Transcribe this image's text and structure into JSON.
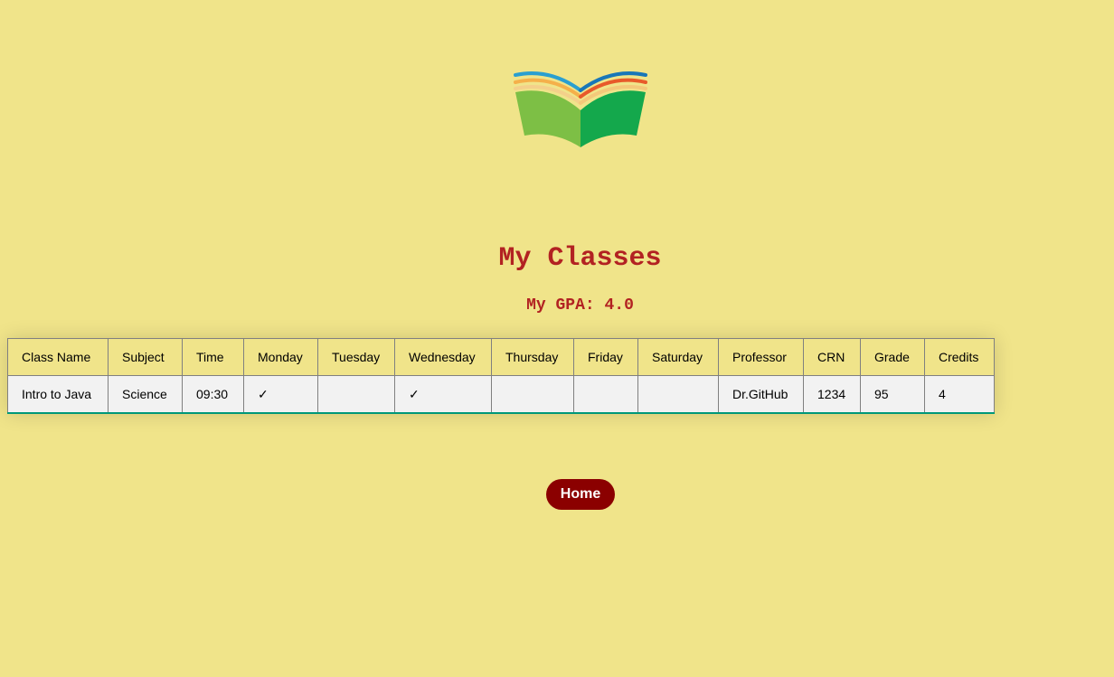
{
  "title": "My Classes",
  "gpa": "My GPA: 4.0",
  "logo_icon": "open-book-icon",
  "table": {
    "headers": [
      "Class Name",
      "Subject",
      "Time",
      "Monday",
      "Tuesday",
      "Wednesday",
      "Thursday",
      "Friday",
      "Saturday",
      "Professor",
      "CRN",
      "Grade",
      "Credits"
    ],
    "rows": [
      [
        "Intro to Java",
        "Science",
        "09:30",
        "✓",
        "",
        "✓",
        "",
        "",
        "",
        "Dr.GitHub",
        "1234",
        "95",
        "4"
      ]
    ]
  },
  "home_button": "Home",
  "colors": {
    "background": "#f0e48a",
    "heading": "#b22222",
    "button": "#8b0000",
    "row_accent": "#009879"
  }
}
